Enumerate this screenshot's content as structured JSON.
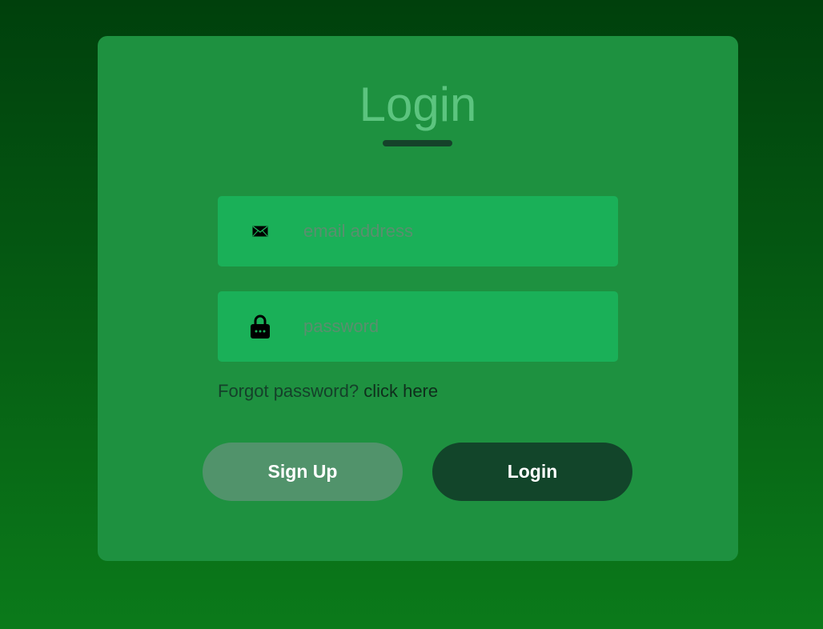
{
  "form": {
    "title": "Login",
    "email": {
      "placeholder": "email address",
      "value": "",
      "icon": "envelope-icon"
    },
    "password": {
      "placeholder": "password",
      "value": "",
      "icon": "lock-icon"
    },
    "forgot": {
      "text": "Forgot password?",
      "link": "click here"
    },
    "buttons": {
      "signup": "Sign Up",
      "login": "Login"
    }
  },
  "colors": {
    "background_top": "#00400c",
    "background_bottom": "#0b7a1a",
    "card": "#1e9140",
    "field": "#1ab058",
    "title": "#5cc47f",
    "signup_button": "#51936b",
    "login_button": "#12452a"
  }
}
